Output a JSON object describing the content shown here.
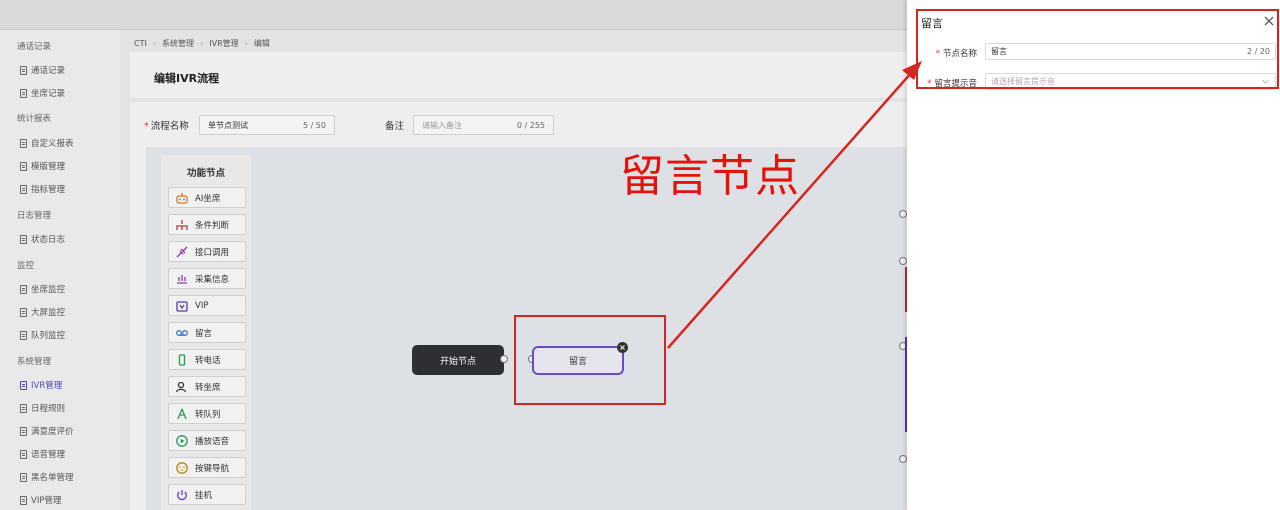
{
  "sidebar": {
    "groups": [
      {
        "label": "通话记录",
        "items": [
          {
            "label": "通话记录"
          },
          {
            "label": "坐席记录"
          }
        ]
      },
      {
        "label": "统计报表",
        "items": [
          {
            "label": "自定义报表"
          },
          {
            "label": "模版管理"
          },
          {
            "label": "指标管理"
          }
        ]
      },
      {
        "label": "日志管理",
        "items": [
          {
            "label": "状态日志"
          }
        ]
      },
      {
        "label": "监控",
        "items": [
          {
            "label": "坐席监控"
          },
          {
            "label": "大屏监控"
          },
          {
            "label": "队列监控"
          }
        ]
      },
      {
        "label": "系统管理",
        "items": [
          {
            "label": "IVR管理",
            "active": true
          },
          {
            "label": "日程规则"
          },
          {
            "label": "满意度评价"
          },
          {
            "label": "语音管理"
          },
          {
            "label": "黑名单管理"
          },
          {
            "label": "VIP管理"
          }
        ]
      }
    ]
  },
  "breadcrumb": [
    "CTI",
    "系统管理",
    "IVR管理",
    "编辑"
  ],
  "page": {
    "title": "编辑IVR流程",
    "flow_name_label": "流程名称",
    "flow_name_value": "单节点测试",
    "flow_name_count": "5 / 50",
    "remark_label": "备注",
    "remark_placeholder": "请输入备注",
    "remark_count": "0 / 255"
  },
  "palette": {
    "title": "功能节点",
    "items": [
      {
        "label": "AI坐席",
        "icon": "robot-icon"
      },
      {
        "label": "条件判断",
        "icon": "branch-icon"
      },
      {
        "label": "接口调用",
        "icon": "plug-icon"
      },
      {
        "label": "采集信息",
        "icon": "collect-icon"
      },
      {
        "label": "VIP",
        "icon": "vip-icon"
      },
      {
        "label": "留言",
        "icon": "voicemail-icon"
      },
      {
        "label": "转电话",
        "icon": "phone-icon"
      },
      {
        "label": "转坐席",
        "icon": "agent-icon"
      },
      {
        "label": "转队列",
        "icon": "queue-icon"
      },
      {
        "label": "播放语音",
        "icon": "play-icon"
      },
      {
        "label": "按键导航",
        "icon": "keypad-icon"
      },
      {
        "label": "挂机",
        "icon": "power-icon"
      }
    ]
  },
  "flow": {
    "start_node_label": "开始节点",
    "message_node_label": "留言"
  },
  "annotation": {
    "text": "留言节点",
    "color": "#e3120b"
  },
  "drawer": {
    "title": "留言",
    "node_name_label": "节点名称",
    "node_name_value": "留言",
    "node_name_count": "2 / 20",
    "prompt_label": "留言提示音",
    "prompt_placeholder": "请选择留言提示音"
  },
  "colors": {
    "accent": "#6a4bc4",
    "required": "#dd3333",
    "annotation": "#d4261f"
  }
}
